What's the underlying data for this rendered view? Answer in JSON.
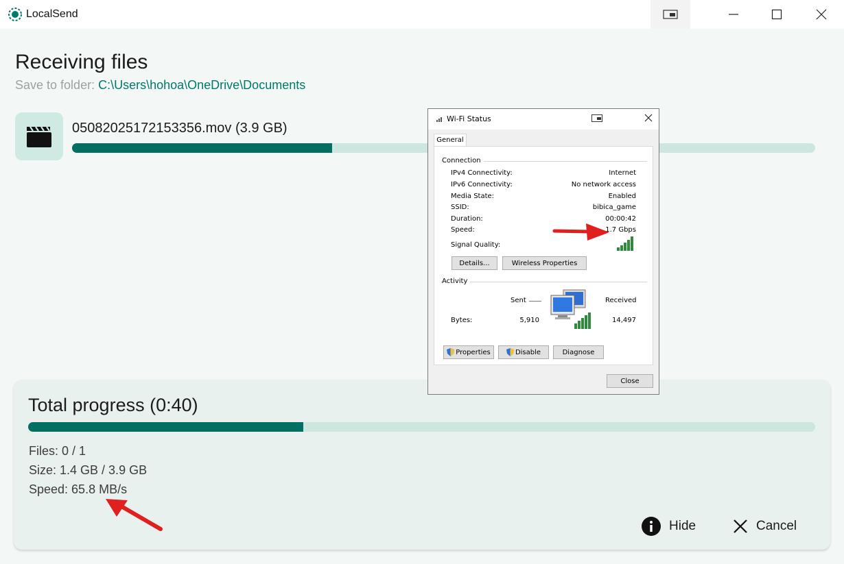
{
  "app": {
    "title": "LocalSend",
    "accent": "#036e62"
  },
  "window_controls": {
    "mini": "compact-overlay-icon",
    "minimize": "minimize-icon",
    "maximize": "maximize-icon",
    "close": "close-icon"
  },
  "main": {
    "title": "Receiving files",
    "save_label": "Save to folder:",
    "save_path": "C:\\Users\\hohoa\\OneDrive\\Documents",
    "file": {
      "name": "05082025172153356.mov (3.9 GB)",
      "icon": "movie-clapper-icon",
      "progress": 0.35
    }
  },
  "progress_card": {
    "title": "Total progress (0:40)",
    "progress": 0.35,
    "files": "Files: 0 / 1",
    "size": "Size: 1.4 GB / 3.9 GB",
    "speed": "Speed: 65.8 MB/s",
    "hide_label": "Hide",
    "cancel_label": "Cancel"
  },
  "wifi_dialog": {
    "title": "Wi-Fi Status",
    "tab": "General",
    "connection_label": "Connection",
    "rows": [
      {
        "label": "IPv4 Connectivity:",
        "value": "Internet"
      },
      {
        "label": "IPv6 Connectivity:",
        "value": "No network access"
      },
      {
        "label": "Media State:",
        "value": "Enabled"
      },
      {
        "label": "SSID:",
        "value": "bibica_game"
      },
      {
        "label": "Duration:",
        "value": "00:00:42"
      },
      {
        "label": "Speed:",
        "value": "1.7 Gbps"
      }
    ],
    "signal_label": "Signal Quality:",
    "details_button": "Details...",
    "wireless_button": "Wireless Properties",
    "activity_label": "Activity",
    "sent_label": "Sent",
    "received_label": "Received",
    "bytes_label": "Bytes:",
    "bytes_sent": "5,910",
    "bytes_received": "14,497",
    "properties_button": "Properties",
    "disable_button": "Disable",
    "diagnose_button": "Diagnose",
    "close_button": "Close"
  }
}
